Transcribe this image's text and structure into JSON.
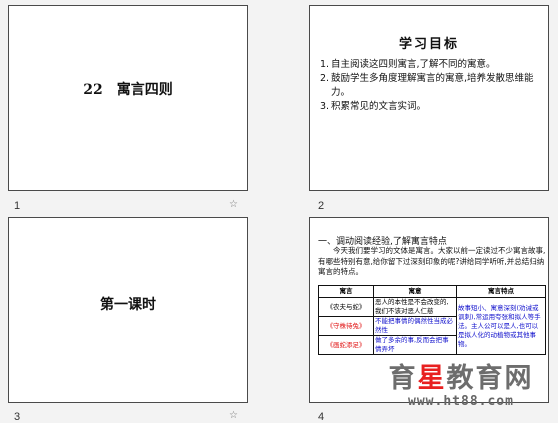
{
  "slides": [
    {
      "number": "1",
      "title": "22　寓言四则"
    },
    {
      "number": "2",
      "title": "学习目标",
      "items": [
        {
          "n": "1.",
          "text": "自主阅读这四则寓言,了解不同的寓意。"
        },
        {
          "n": "2.",
          "text": "鼓励学生多角度理解寓言的寓意,培养发散思维能力。"
        },
        {
          "n": "3.",
          "text": "积累常见的文言实词。"
        }
      ]
    },
    {
      "number": "3",
      "title": "第一课时"
    },
    {
      "number": "4",
      "heading": "一、调动阅读经验,了解寓言特点",
      "paragraph": "　　今天我们要学习的文体是寓言。大家以前一定读过不少寓言故事,有哪些特别有意,给你留下过深刻印象的呢?讲给同学听听,并总结归纳寓言的特点。",
      "table": {
        "headers": [
          "寓言",
          "寓意",
          "寓言特点"
        ],
        "rows": [
          {
            "story": "《农夫与蛇》",
            "meaning": "恶人的本性是不会改变的,我们不该对恶人仁慈"
          },
          {
            "story": "《守株待兔》",
            "meaning": "不能把事情的偶然性当成必然性"
          },
          {
            "story": "《画蛇添足》",
            "meaning": "做了多余的事,反而会把事情弄坏"
          }
        ],
        "feature": "故事短小、寓意深刻(劝诫或讽刺),常运用夸张和拟人等手法。主人公可以是人,也可以是拟人化的动植物或其他事物。"
      }
    }
  ],
  "star_icon_label": "☆",
  "colors": {
    "red": "#e01010",
    "blue": "#1010cc",
    "watermark_highlight": "#e82020"
  },
  "watermark": {
    "part1": "育",
    "highlight": "星",
    "part2": "教育网",
    "url": "www.ht88.com"
  }
}
